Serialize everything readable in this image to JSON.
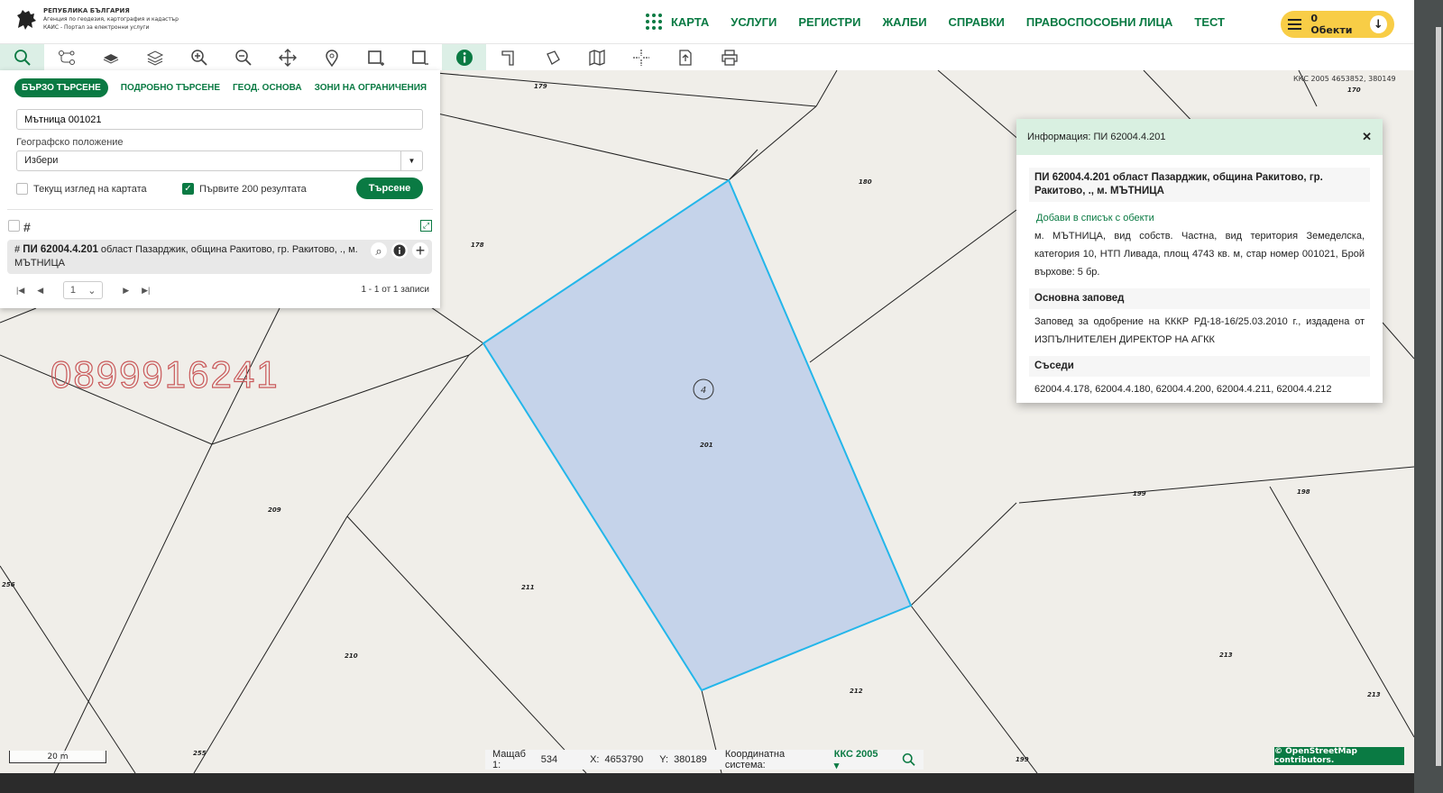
{
  "logo": {
    "line1": "РЕПУБЛИКА БЪЛГАРИЯ",
    "line2": "Агенция по геодезия, картография и кадастър",
    "line3": "КАИС - Портал за електронни услуги"
  },
  "nav": {
    "items": [
      "КАРТА",
      "УСЛУГИ",
      "РЕГИСТРИ",
      "ЖАЛБИ",
      "СПРАВКИ",
      "ПРАВОСПОСОБНИ ЛИЦА",
      "ТЕСТ"
    ],
    "objects_label": "0 Обекти"
  },
  "toolbar": {
    "tools": [
      "search-icon",
      "route-icon",
      "layer-icon",
      "layers-icon",
      "zoom-in-icon",
      "zoom-out-icon",
      "pan-icon",
      "pin-icon",
      "select-rect-icon",
      "deselect-rect-icon",
      "info-icon",
      "measure-icon",
      "polygon-icon",
      "map-icon",
      "crosshair-icon",
      "export-icon",
      "print-icon"
    ],
    "active": [
      "search-icon",
      "info-icon"
    ]
  },
  "search": {
    "tabs": [
      "БЪРЗО ТЪРСЕНЕ",
      "ПОДРОБНО ТЪРСЕНЕ",
      "ГЕОД. ОСНОВА",
      "ЗОНИ НА ОГРАНИЧЕНИЯ"
    ],
    "input_value": "Мътница 001021",
    "geo_label": "Географско положение",
    "geo_value": "Избери",
    "chk_view_label": "Текущ изглед на картата",
    "chk_first_label": "Първите 200 резултата",
    "search_button": "Търсене",
    "result": {
      "id": "ПИ 62004.4.201",
      "text": " област Пазарджик, община Ракитово, гр. Ракитово, ., м. МЪТНИЦА"
    },
    "page": "1",
    "record_count": "1 - 1 от 1 записи"
  },
  "info": {
    "header": "Информация: ПИ 62004.4.201",
    "title": "ПИ 62004.4.201 област Пазарджик, община Ракитово, гр. Ракитово, ., м. МЪТНИЦА",
    "add_link": "Добави в списък с обекти",
    "description": "м. МЪТНИЦА, вид собств. Частна, вид територия Земеделска, категория 10, НТП Ливада, площ 4743 кв. м, стар номер 001021, Брой върхове: 5 бр.",
    "order_title": "Основна заповед",
    "order_text": "Заповед за одобрение на КККР РД-18-16/25.03.2010 г., издадена от ИЗПЪЛНИТЕЛЕН ДИРЕКТОР НА АГКК",
    "neighbors_title": "Съседи",
    "neighbors_text": "62004.4.178, 62004.4.180, 62004.4.200, 62004.4.211, 62004.4.212"
  },
  "map": {
    "parcel_labels": [
      "179",
      "170",
      "180",
      "178",
      "201",
      "209",
      "211",
      "210",
      "212",
      "199",
      "198",
      "213",
      "213",
      "256",
      "255",
      "199"
    ],
    "vertex_count_label": "4",
    "top_coords": "ККС 2005 4653852, 380149",
    "watermark": "0899916241",
    "scale_bar": "20 m",
    "osm_credit": "© OpenStreetMap contributors."
  },
  "status": {
    "scale_label": "Мащаб 1:",
    "scale_value": "534",
    "x_label": "X:",
    "x_value": "4653790",
    "y_label": "Y:",
    "y_value": "380189",
    "coordsys_label": "Координатна система:",
    "coordsys_value": "ККС 2005"
  },
  "colors": {
    "accent": "#0a7a43",
    "parcel_fill": "#c5d3ea",
    "parcel_stroke": "#23b6ea",
    "objects_button": "#f8cd46"
  }
}
